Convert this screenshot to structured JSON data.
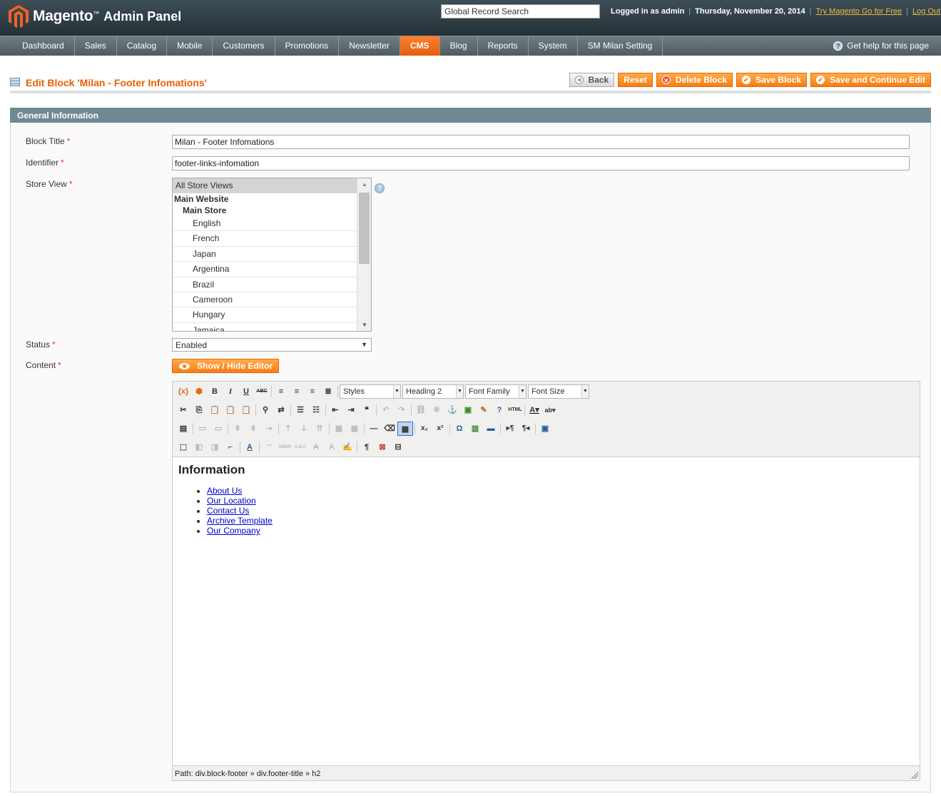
{
  "app": {
    "brand": "Magento",
    "brand_tm": "™",
    "product": "Admin Panel"
  },
  "header": {
    "search_placeholder": "Global Record Search",
    "logged_in": "Logged in as admin",
    "date": "Thursday, November 20, 2014",
    "try_link": "Try Magento Go for Free",
    "logout_link": "Log Out"
  },
  "nav": {
    "items": [
      "Dashboard",
      "Sales",
      "Catalog",
      "Mobile",
      "Customers",
      "Promotions",
      "Newsletter",
      "CMS",
      "Blog",
      "Reports",
      "System",
      "SM Milan Setting"
    ],
    "active": "CMS",
    "help": "Get help for this page"
  },
  "page": {
    "title": "Edit Block 'Milan - Footer Infomations'"
  },
  "buttons": {
    "back": "Back",
    "reset": "Reset",
    "delete": "Delete Block",
    "save": "Save Block",
    "save_continue": "Save and Continue Edit"
  },
  "fieldset": {
    "title": "General Information"
  },
  "form": {
    "block_title_label": "Block Title",
    "block_title_value": "Milan - Footer Infomations",
    "identifier_label": "Identifier",
    "identifier_value": "footer-links-infomation",
    "store_view_label": "Store View",
    "store_options": {
      "all": "All Store Views",
      "website": "Main Website",
      "store": "Main Store",
      "views": [
        "English",
        "French",
        "Japan",
        "Argentina",
        "Brazil",
        "Cameroon",
        "Hungary",
        "Jamaica"
      ]
    },
    "status_label": "Status",
    "status_value": "Enabled",
    "content_label": "Content",
    "show_hide": "Show / Hide Editor",
    "required": "*"
  },
  "editor": {
    "dropdowns": {
      "styles": "Styles",
      "format": "Heading 2",
      "font_family": "Font Family",
      "font_size": "Font Size"
    },
    "heading": "Information",
    "links": [
      "About Us",
      "Our Location",
      "Contact Us",
      "Archive Template",
      "Our Company"
    ],
    "path": "Path: div.block-footer » div.footer-title » h2"
  },
  "colors": {
    "accent": "#eb5e00",
    "header_bg": "#253037",
    "nav_bg": "#5c686e",
    "fieldset_head": "#6f8992"
  }
}
